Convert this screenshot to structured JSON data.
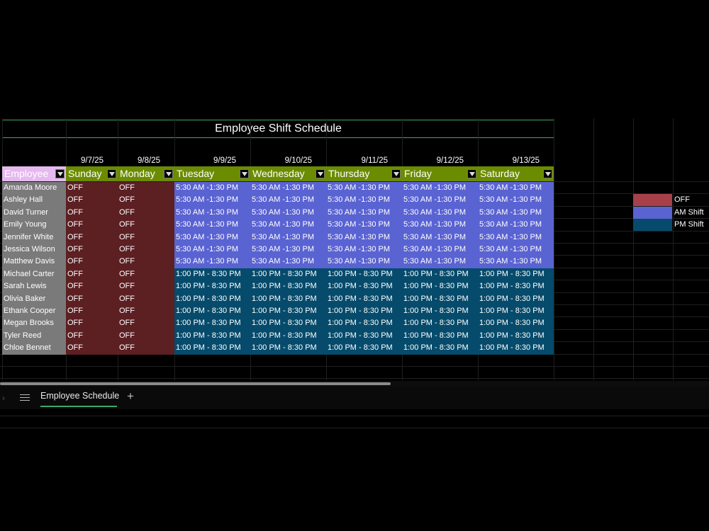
{
  "sheet": {
    "title": "Employee Shift Schedule",
    "dates": [
      "9/7/25",
      "9/8/25",
      "9/9/25",
      "9/10/25",
      "9/11/25",
      "9/12/25",
      "9/13/25"
    ],
    "headers": [
      "Employee",
      "Sunday",
      "Monday",
      "Tuesday",
      "Wednesday",
      "Thursday",
      "Friday",
      "Saturday"
    ],
    "rows": [
      {
        "name": "Amanda Moore",
        "shifts": [
          "OFF",
          "OFF",
          "5:30 AM -1:30 PM",
          "5:30 AM -1:30 PM",
          "5:30 AM -1:30 PM",
          "5:30 AM -1:30 PM",
          "5:30 AM -1:30 PM"
        ]
      },
      {
        "name": "Ashley Hall",
        "shifts": [
          "OFF",
          "OFF",
          "5:30 AM -1:30 PM",
          "5:30 AM -1:30 PM",
          "5:30 AM -1:30 PM",
          "5:30 AM -1:30 PM",
          "5:30 AM -1:30 PM"
        ]
      },
      {
        "name": "David Turner",
        "shifts": [
          "OFF",
          "OFF",
          "5:30 AM -1:30 PM",
          "5:30 AM -1:30 PM",
          "5:30 AM -1:30 PM",
          "5:30 AM -1:30 PM",
          "5:30 AM -1:30 PM"
        ]
      },
      {
        "name": "Emily Young",
        "shifts": [
          "OFF",
          "OFF",
          "5:30 AM -1:30 PM",
          "5:30 AM -1:30 PM",
          "5:30 AM -1:30 PM",
          "5:30 AM -1:30 PM",
          "5:30 AM -1:30 PM"
        ]
      },
      {
        "name": "Jennifer White",
        "shifts": [
          "OFF",
          "OFF",
          "5:30 AM -1:30 PM",
          "5:30 AM -1:30 PM",
          "5:30 AM -1:30 PM",
          "5:30 AM -1:30 PM",
          "5:30 AM -1:30 PM"
        ]
      },
      {
        "name": "Jessica Wilson",
        "shifts": [
          "OFF",
          "OFF",
          "5:30 AM -1:30 PM",
          "5:30 AM -1:30 PM",
          "5:30 AM -1:30 PM",
          "5:30 AM -1:30 PM",
          "5:30 AM -1:30 PM"
        ]
      },
      {
        "name": "Matthew Davis",
        "shifts": [
          "OFF",
          "OFF",
          "5:30 AM -1:30 PM",
          "5:30 AM -1:30 PM",
          "5:30 AM -1:30 PM",
          "5:30 AM -1:30 PM",
          "5:30 AM -1:30 PM"
        ]
      },
      {
        "name": "Michael Carter",
        "shifts": [
          "OFF",
          "OFF",
          "1:00 PM - 8:30 PM",
          "1:00 PM - 8:30 PM",
          "1:00 PM - 8:30 PM",
          "1:00 PM - 8:30 PM",
          "1:00 PM - 8:30 PM"
        ]
      },
      {
        "name": "Sarah Lewis",
        "shifts": [
          "OFF",
          "OFF",
          "1:00 PM - 8:30 PM",
          "1:00 PM - 8:30 PM",
          "1:00 PM - 8:30 PM",
          "1:00 PM - 8:30 PM",
          "1:00 PM - 8:30 PM"
        ]
      },
      {
        "name": "Olivia Baker",
        "shifts": [
          "OFF",
          "OFF",
          "1:00 PM - 8:30 PM",
          "1:00 PM - 8:30 PM",
          "1:00 PM - 8:30 PM",
          "1:00 PM - 8:30 PM",
          "1:00 PM - 8:30 PM"
        ]
      },
      {
        "name": "Ethank Cooper",
        "shifts": [
          "OFF",
          "OFF",
          "1:00 PM - 8:30 PM",
          "1:00 PM - 8:30 PM",
          "1:00 PM - 8:30 PM",
          "1:00 PM - 8:30 PM",
          "1:00 PM - 8:30 PM"
        ]
      },
      {
        "name": "Megan Brooks",
        "shifts": [
          "OFF",
          "OFF",
          "1:00 PM - 8:30 PM",
          "1:00 PM - 8:30 PM",
          "1:00 PM - 8:30 PM",
          "1:00 PM - 8:30 PM",
          "1:00 PM - 8:30 PM"
        ]
      },
      {
        "name": "Tyler Reed",
        "shifts": [
          "OFF",
          "OFF",
          "1:00 PM - 8:30 PM",
          "1:00 PM - 8:30 PM",
          "1:00 PM - 8:30 PM",
          "1:00 PM - 8:30 PM",
          "1:00 PM - 8:30 PM"
        ]
      },
      {
        "name": "Chloe Bennet",
        "shifts": [
          "OFF",
          "OFF",
          "1:00 PM - 8:30 PM",
          "1:00 PM - 8:30 PM",
          "1:00 PM - 8:30 PM",
          "1:00 PM - 8:30 PM",
          "1:00 PM - 8:30 PM"
        ]
      }
    ]
  },
  "legend": [
    {
      "label": "OFF",
      "color": "#a8404a"
    },
    {
      "label": "AM Shift",
      "color": "#5a63d2"
    },
    {
      "label": "PM Shift",
      "color": "#064b6b"
    }
  ],
  "colors": {
    "header_green": "#6b8c00",
    "employee_header": "#e6b8f0",
    "name_col": "#7a7a7a",
    "off": "#5c1f22",
    "am_shift": "#5a63d2",
    "pm_shift": "#064b6b",
    "accent": "#3fa56b"
  },
  "tabs": {
    "active": "Employee Schedule",
    "add_icon": "plus-icon",
    "menu_icon": "hamburger-menu-icon",
    "nav_icon": "chevron-right-icon"
  }
}
